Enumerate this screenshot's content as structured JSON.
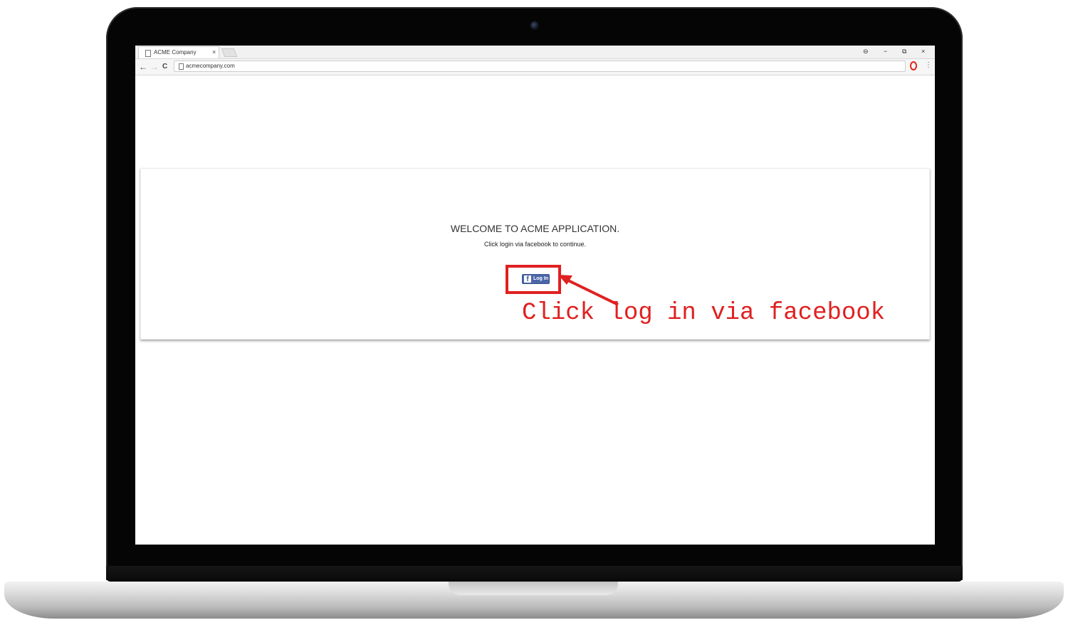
{
  "browser": {
    "tab_title": "ACME Company",
    "tab_close": "×",
    "url": "acmecompany.com",
    "window_controls": {
      "account": "⊖",
      "minimize": "−",
      "restore": "⧉",
      "close": "×"
    },
    "nav": {
      "back": "←",
      "forward": "→",
      "reload": "C"
    },
    "menu": "⋮"
  },
  "page": {
    "welcome_title": "WELCOME TO ACME APPLICATION.",
    "subtitle": "Click login via facebook to continue.",
    "fb_login_label": "Log In",
    "fb_icon_glyph": "f"
  },
  "annotation": {
    "text": "Click log in via facebook",
    "color": "#e02020"
  },
  "colors": {
    "facebook_blue": "#4a66a8",
    "annotation_red": "#e02020"
  }
}
